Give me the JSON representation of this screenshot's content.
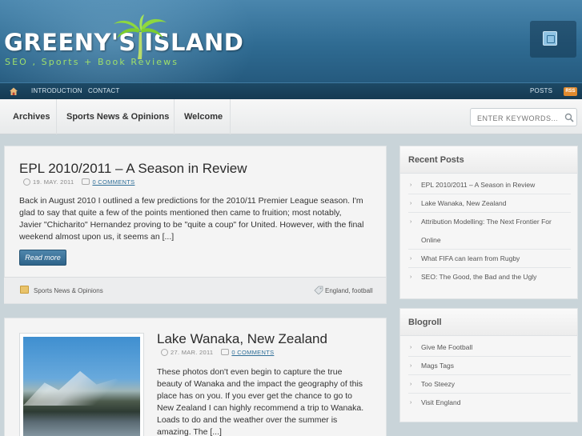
{
  "site": {
    "title": "GREENY'S ISLAND",
    "tagline": "SEO , Sports + Book Reviews"
  },
  "topnav": {
    "links": [
      "INTRODUCTION",
      "CONTACT"
    ],
    "posts_label": "POSTS",
    "rss_label": "RSS"
  },
  "menu": {
    "items": [
      "Archives",
      "Sports News & Opinions",
      "Welcome"
    ]
  },
  "search": {
    "placeholder": "ENTER KEYWORDS..."
  },
  "posts": [
    {
      "title": "EPL 2010/2011 – A Season in Review",
      "date": "19. MAY. 2011",
      "comments": "0 COMMENTS",
      "excerpt_lines": [
        "Back in August 2010 I outlined a few predictions for the 2010/11 Premier League season. I'm",
        "glad to say that quite a few of the points mentioned then came to fruition; most notably,",
        "Javier \"Chicharito\" Hernandez proving to be \"quite a coup\" for United. However, with the final",
        "weekend almost upon us, it seems an [...]"
      ],
      "read_more": "Read more",
      "category": "Sports News & Opinions",
      "tags": "England, football"
    },
    {
      "title": "Lake Wanaka, New Zealand",
      "date": "27. MAR. 2011",
      "comments": "0 COMMENTS",
      "excerpt_lines": [
        "These photos don't even begin to capture the true",
        "beauty of Wanaka and the impact the geography of this",
        "place has on you.   If you ever get the chance to go to",
        "New Zealand I can highly recommend a trip to Wanaka.",
        "Loads to do and the weather over the summer is",
        "amazing. The [...]"
      ]
    }
  ],
  "sidebar": {
    "recent_posts": {
      "title": "Recent Posts",
      "items": [
        "EPL 2010/2011 – A Season in Review",
        "Lake Wanaka, New Zealand",
        "Attribution Modelling: The Next Frontier For",
        "Online",
        "What FIFA can learn from Rugby",
        "SEO: The Good, the Bad and the Ugly"
      ]
    },
    "blogroll": {
      "title": "Blogroll",
      "items": [
        "Give Me Football",
        "Mags Tags",
        "Too Steezy",
        "Visit England"
      ]
    }
  },
  "colors": {
    "header_blue": "#2f6b92",
    "tagline_green": "#9fe06a",
    "button_blue": "#2e6389",
    "rss_orange": "#e08a2e"
  }
}
